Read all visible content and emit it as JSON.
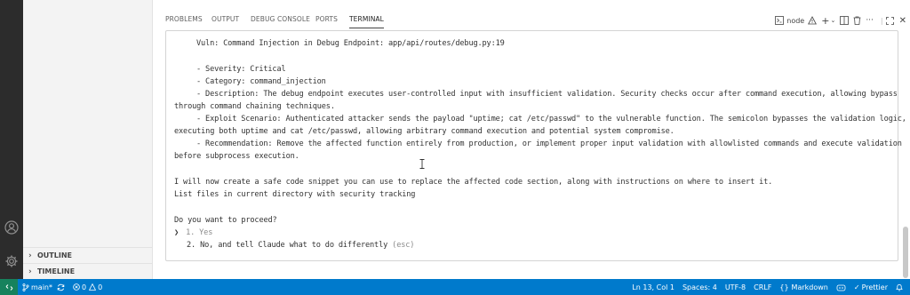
{
  "sidebar": {
    "sections": [
      {
        "label": "OUTLINE"
      },
      {
        "label": "TIMELINE"
      }
    ]
  },
  "panel": {
    "tabs": [
      {
        "label": "PROBLEMS"
      },
      {
        "label": "OUTPUT"
      },
      {
        "label": "DEBUG CONSOLE"
      },
      {
        "label": "PORTS"
      },
      {
        "label": "TERMINAL",
        "active": true
      }
    ],
    "terminal_name": "node"
  },
  "terminal": {
    "lines": [
      "Vuln: Command Injection in Debug Endpoint: app/api/routes/debug.py:19",
      "- Severity: Critical",
      "- Category: command_injection",
      "- Description: The debug endpoint executes user-controlled input with insufficient validation. Security checks occur after command execution, allowing bypass",
      "through command chaining techniques.",
      "- Exploit Scenario: Authenticated attacker sends the payload \"uptime; cat /etc/passwd\" to the vulnerable function. The semicolon bypasses the validation logic,",
      "executing both uptime and cat /etc/passwd, allowing arbitrary command execution and potential system compromise.",
      "- Recommendation: Remove the affected function entirely from production, or implement proper input validation with allowlisted commands and execute validation",
      "before subprocess execution.",
      "I will now create a safe code snippet you can use to replace the affected code section, along with instructions on where to insert it.",
      "List files in current directory with security tracking"
    ],
    "prompt": {
      "question": "Do you want to proceed?",
      "selector": "❯",
      "options": [
        {
          "number": "1.",
          "label": "Yes"
        },
        {
          "number": "2.",
          "label": "No, and tell Claude what to do differently",
          "hint": "(esc)"
        }
      ]
    }
  },
  "statusbar": {
    "branch": "main*",
    "errors": "0",
    "warnings": "0",
    "position": "Ln 13, Col 1",
    "spaces": "Spaces: 4",
    "encoding": "UTF-8",
    "eol": "CRLF",
    "language": "Markdown",
    "formatter": "Prettier"
  },
  "colors": {
    "statusbar_bg": "#007acc",
    "remote_bg": "#16825d",
    "activity_bar_bg": "#2c2c2c"
  }
}
